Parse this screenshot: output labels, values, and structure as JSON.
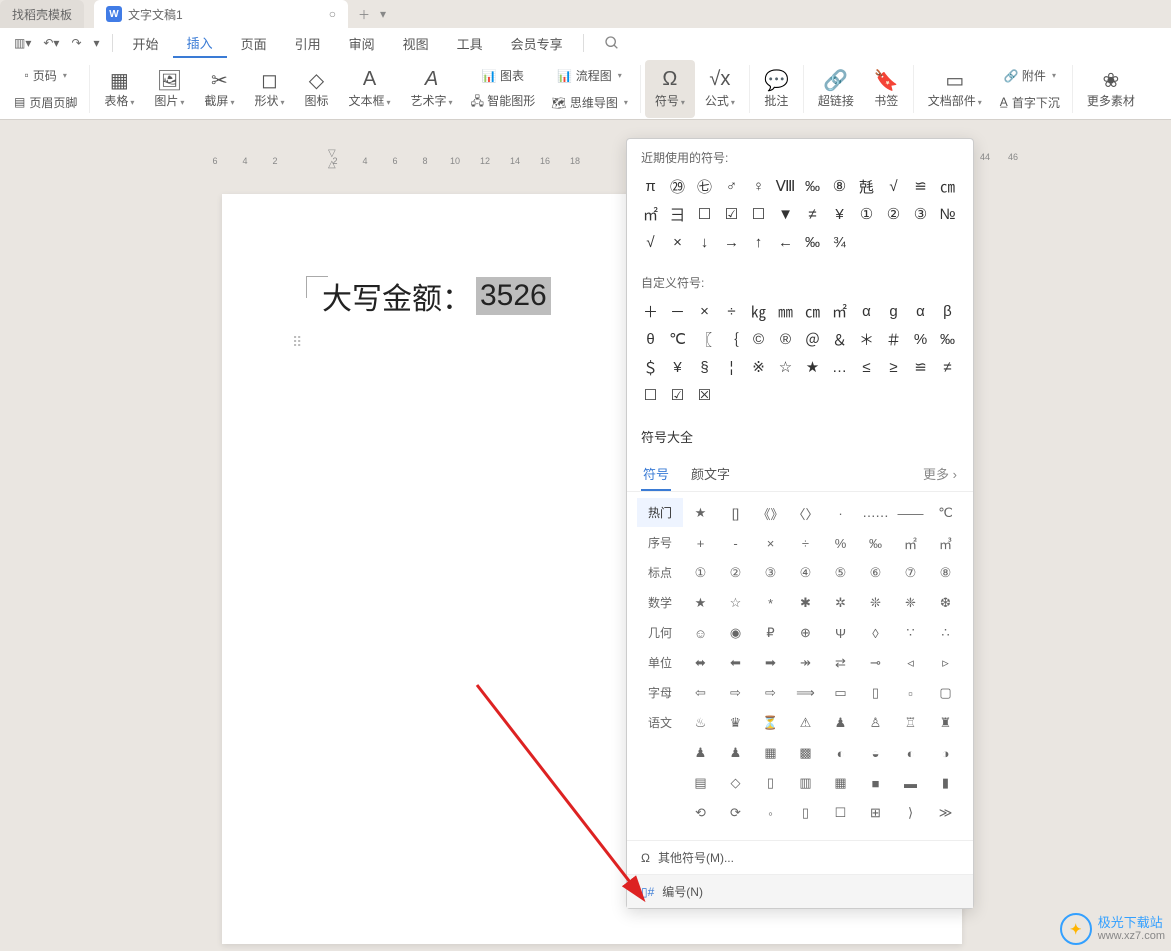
{
  "tabs": {
    "inactive_label": "找稻壳模板",
    "active_label": "文字文稿1",
    "active_icon": "W"
  },
  "menubar": {
    "items": [
      "开始",
      "插入",
      "页面",
      "引用",
      "审阅",
      "视图",
      "工具",
      "会员专享"
    ],
    "active_index": 1
  },
  "ribbon": {
    "col1": {
      "a": "页码",
      "b": "页眉页脚"
    },
    "table": "表格",
    "pic": "图片",
    "screen": "截屏",
    "shape": "形状",
    "icon": "图标",
    "textbox": "文本框",
    "artword": "艺术字",
    "chart": "📊 图表",
    "smartart": "🖧 智能图形",
    "flowchart": "📊 流程图",
    "mindmap": "🗺 思维导图",
    "symbol": "符号",
    "formula": "公式",
    "comment": "批注",
    "hyperlink": "超链接",
    "bookmark": "书签",
    "docparts": "文档部件",
    "attach": "🔗 附件",
    "dropcap": "首字下沉",
    "more": "更多素材"
  },
  "doc": {
    "label": "大写金额：",
    "value": "3526"
  },
  "panel": {
    "recent_title": "近期使用的符号:",
    "recent": [
      "π",
      "㉙",
      "㊆",
      "♂",
      "♀",
      "Ⅷ",
      "‰",
      "⑧",
      "兞",
      "√",
      "≌",
      "㎝",
      "㎡",
      "⺕",
      "☐",
      "☑",
      "☐",
      "▼",
      "≠",
      "¥",
      "①",
      "②",
      "③",
      "№",
      "√",
      "×",
      "↓",
      "→",
      "↑",
      "←",
      "‰",
      "¾"
    ],
    "custom_title": "自定义符号:",
    "custom": [
      "＋",
      "－",
      "×",
      "÷",
      "㎏",
      "㎜",
      "㎝",
      "㎡",
      "α",
      "g",
      "α",
      "β",
      "θ",
      "℃",
      "〖",
      "｛",
      "©",
      "®",
      "＠",
      "＆",
      "＊",
      "＃",
      "%",
      "‰",
      "＄",
      "¥",
      "§",
      "¦",
      "※",
      "☆",
      "★",
      "…",
      "≤",
      "≥",
      "≌",
      "≠",
      "☐",
      "☑",
      "☒"
    ],
    "all_title": "符号大全",
    "tabs": {
      "symbol": "符号",
      "emoji": "颜文字",
      "more": "更多"
    },
    "cats": [
      "热门",
      "序号",
      "标点",
      "数学",
      "几何",
      "单位",
      "字母",
      "语文"
    ],
    "grid": [
      [
        "★",
        "[]",
        "《》",
        "〈〉",
        "·",
        "‥‥‥",
        "——",
        "℃"
      ],
      [
        "+",
        "-",
        "×",
        "÷",
        "%",
        "‰",
        "㎡",
        "㎥"
      ],
      [
        "①",
        "②",
        "③",
        "④",
        "⑤",
        "⑥",
        "⑦",
        "⑧"
      ],
      [
        "★",
        "☆",
        "*",
        "✱",
        "✲",
        "❊",
        "❈",
        "❆"
      ],
      [
        "☺",
        "◉",
        "₽",
        "⊕",
        "Ψ",
        "◊",
        "∵",
        "∴"
      ],
      [
        "⬌",
        "⬅",
        "➡",
        "↠",
        "⇄",
        "⊸",
        "◃",
        "▹"
      ],
      [
        "⇦",
        "⇨",
        "⇨",
        "⟹",
        "▭",
        "▯",
        "▫",
        "▢"
      ],
      [
        "♨",
        "♛",
        "⏳",
        "⚠",
        "♟",
        "♙",
        "♖",
        "♜"
      ],
      [
        "♟",
        "♟",
        "▦",
        "▩",
        "◐",
        "◒",
        "◐",
        "◑"
      ],
      [
        "▤",
        "◇",
        "▯",
        "▥",
        "▦",
        "■",
        "▬",
        "▮"
      ],
      [
        "⟲",
        "⟳",
        "◦",
        "▯",
        "☐",
        "⊞",
        "⟩",
        "≫"
      ]
    ],
    "other_symbols": "其他符号(M)...",
    "number": "编号(N)"
  },
  "watermark": {
    "name": "极光下载站",
    "url": "www.xz7.com"
  }
}
